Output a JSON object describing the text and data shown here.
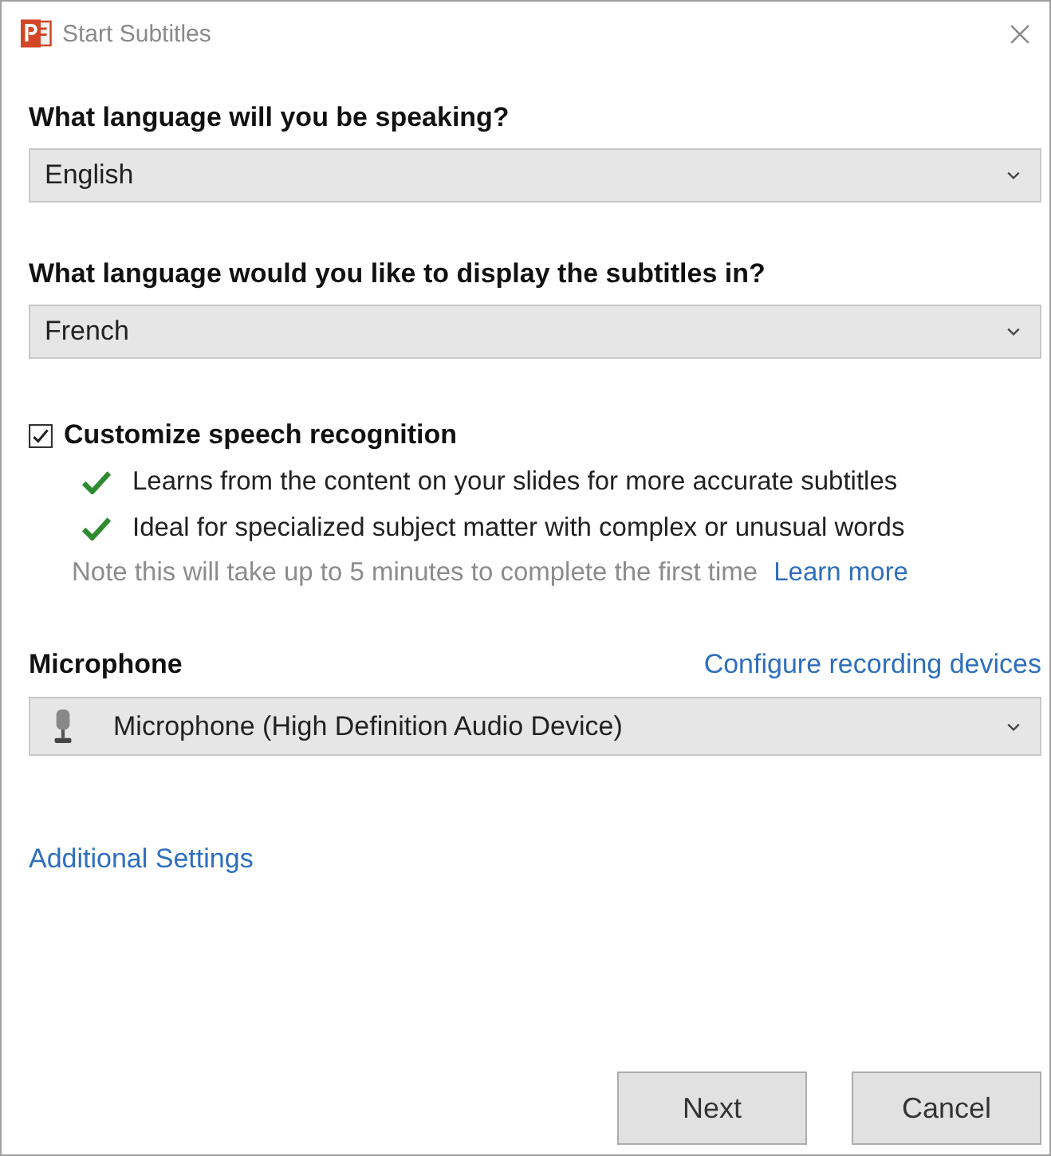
{
  "window": {
    "title": "Start Subtitles"
  },
  "speaking_language": {
    "label": "What language will you be speaking?",
    "value": "English"
  },
  "subtitle_language": {
    "label": "What language would you like to display the subtitles in?",
    "value": "French"
  },
  "customize": {
    "label": "Customize speech recognition",
    "checked": true,
    "benefits": [
      "Learns from the content on your slides for more accurate subtitles",
      "Ideal for specialized subject matter with complex or unusual words"
    ],
    "note": "Note this will take up to 5 minutes to complete the first time",
    "link": "Learn more"
  },
  "microphone": {
    "label": "Microphone",
    "link": "Configure recording devices",
    "value": "Microphone (High Definition Audio Device)"
  },
  "additional_settings": "Additional Settings",
  "buttons": [
    "Next",
    "Cancel"
  ]
}
